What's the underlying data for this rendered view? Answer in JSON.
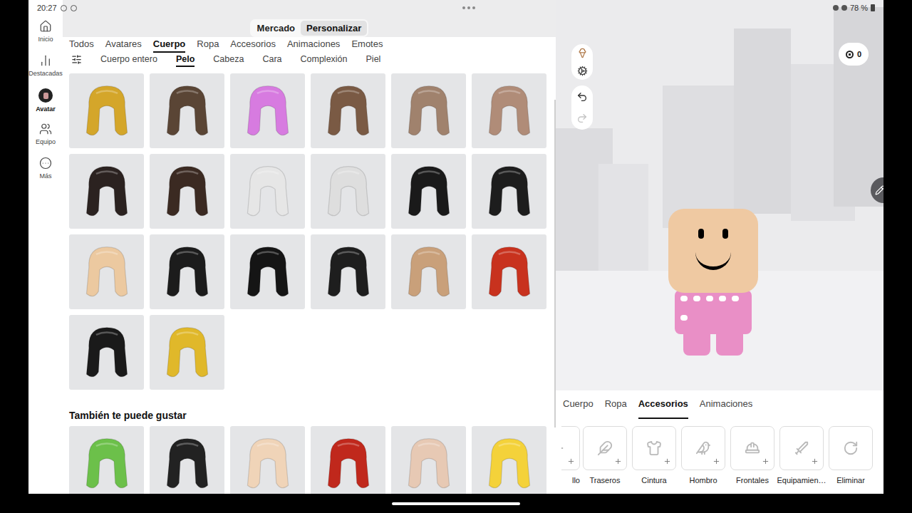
{
  "status_bar": {
    "time": "20:27",
    "battery": "78 %"
  },
  "top_toggle": [
    {
      "label": "Mercado",
      "selected": false
    },
    {
      "label": "Personalizar",
      "selected": true
    }
  ],
  "nav": [
    {
      "label": "Inicio",
      "selected": false
    },
    {
      "label": "Destacadas",
      "selected": false
    },
    {
      "label": "Avatar",
      "selected": true
    },
    {
      "label": "Equipo",
      "selected": false
    },
    {
      "label": "Más",
      "selected": false
    }
  ],
  "tabs": [
    {
      "label": "Todos",
      "selected": false
    },
    {
      "label": "Avatares",
      "selected": false
    },
    {
      "label": "Cuerpo",
      "selected": true
    },
    {
      "label": "Ropa",
      "selected": false
    },
    {
      "label": "Accesorios",
      "selected": false
    },
    {
      "label": "Animaciones",
      "selected": false
    },
    {
      "label": "Emotes",
      "selected": false
    }
  ],
  "subtabs": [
    {
      "label": "Cuerpo entero",
      "selected": false
    },
    {
      "label": "Pelo",
      "selected": true
    },
    {
      "label": "Cabeza",
      "selected": false
    },
    {
      "label": "Cara",
      "selected": false
    },
    {
      "label": "Complexión",
      "selected": false
    },
    {
      "label": "Piel",
      "selected": false
    }
  ],
  "items": [
    {
      "color": "#d4a62a"
    },
    {
      "color": "#5a4535"
    },
    {
      "color": "#d77be0"
    },
    {
      "color": "#7a5a44"
    },
    {
      "color": "#a0826d"
    },
    {
      "color": "#b08c78"
    },
    {
      "color": "#2b2220"
    },
    {
      "color": "#3b2a22"
    },
    {
      "color": "#e6e6e6"
    },
    {
      "color": "#dedede"
    },
    {
      "color": "#1a1a1a"
    },
    {
      "color": "#1d1d1d"
    },
    {
      "color": "#ecc9a0"
    },
    {
      "color": "#1c1c1c"
    },
    {
      "color": "#151515"
    },
    {
      "color": "#1e1e1e"
    },
    {
      "color": "#c9a07a"
    },
    {
      "color": "#c8321e"
    },
    {
      "color": "#1a1a1a"
    },
    {
      "color": "#e0b82a"
    }
  ],
  "suggestions": {
    "title": "También te puede gustar",
    "items": [
      {
        "color": "#6cc04a"
      },
      {
        "color": "#222222"
      },
      {
        "color": "#f0d4b8"
      },
      {
        "color": "#c0281c"
      },
      {
        "color": "#e7c9b4"
      },
      {
        "color": "#f4d23a"
      }
    ]
  },
  "robux": {
    "count": "0"
  },
  "history": {
    "undo_enabled": true,
    "redo_enabled": false
  },
  "bottom_tabs": [
    {
      "label": "Cuerpo",
      "selected": false
    },
    {
      "label": "Ropa",
      "selected": false
    },
    {
      "label": "Accesorios",
      "selected": true
    },
    {
      "label": "Animaciones",
      "selected": false
    }
  ],
  "slots": [
    {
      "label": "llo",
      "kind": "add"
    },
    {
      "label": "Traseros",
      "kind": "add"
    },
    {
      "label": "Cintura",
      "kind": "add"
    },
    {
      "label": "Hombro",
      "kind": "add"
    },
    {
      "label": "Frontales",
      "kind": "add"
    },
    {
      "label": "Equipamien…",
      "kind": "add"
    },
    {
      "label": "Eliminar",
      "kind": "reset"
    }
  ]
}
